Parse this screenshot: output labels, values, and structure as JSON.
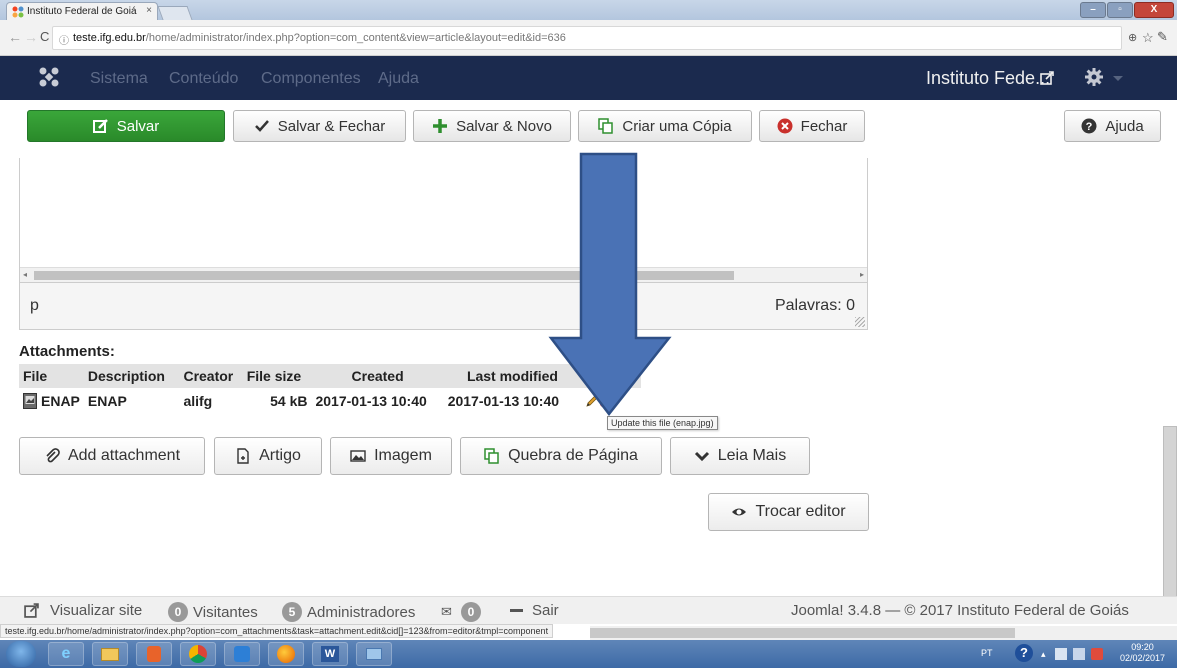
{
  "browser": {
    "tab_title": "Instituto Federal de Goiá",
    "tab_close": "×",
    "url_host": "teste.ifg.edu.br",
    "url_path": "/home/administrator/index.php?option=com_content&view=article&layout=edit&id=636",
    "window_buttons": [
      "–",
      "▫",
      "X"
    ],
    "hover_url": "teste.ifg.edu.br/home/administrator/index.php?option=com_attachments&task=attachment.edit&cid[]=123&from=editor&tmpl=component"
  },
  "topnav": {
    "menu": [
      "Sistema",
      "Conteúdo",
      "Componentes",
      "Ajuda"
    ],
    "site_title": "Instituto Fede...",
    "brand_color": "#1b2a4e"
  },
  "toolbar": {
    "save": "Salvar",
    "save_close": "Salvar & Fechar",
    "save_new": "Salvar & Novo",
    "save_copy": "Criar uma Cópia",
    "close": "Fechar",
    "help": "Ajuda"
  },
  "editor": {
    "path": "p",
    "word_count": "Palavras: 0"
  },
  "attachments": {
    "title": "Attachments:",
    "columns": [
      "File",
      "Description",
      "Creator",
      "File size",
      "Created",
      "Last modified"
    ],
    "rows": [
      {
        "file": "ENAP",
        "description": "ENAP",
        "creator": "alifg",
        "size": "54 kB",
        "created": "2017-01-13 10:40",
        "modified": "2017-01-13 10:40"
      }
    ],
    "tooltip": "Update this file (enap.jpg)"
  },
  "editor_buttons": {
    "add_attachment": "Add attachment",
    "article": "Artigo",
    "image": "Imagem",
    "page_break": "Quebra de Página",
    "read_more": "Leia Mais",
    "toggle_editor": "Trocar editor"
  },
  "footer": {
    "view_site": "Visualizar site",
    "visitors_count": "0",
    "visitors": "Visitantes",
    "admins_count": "5",
    "admins": "Administradores",
    "messages_count": "0",
    "logout": "Sair",
    "copyright": "Joomla! 3.4.8 — © 2017 Instituto Federal de Goiás"
  },
  "taskbar": {
    "lang": "PT",
    "time": "09:20",
    "date": "02/02/2017"
  },
  "colors": {
    "arrow": "#4a72b5",
    "arrow_border": "#2e4f86",
    "green": "#2f8f2f",
    "close_red": "#c9302c"
  }
}
